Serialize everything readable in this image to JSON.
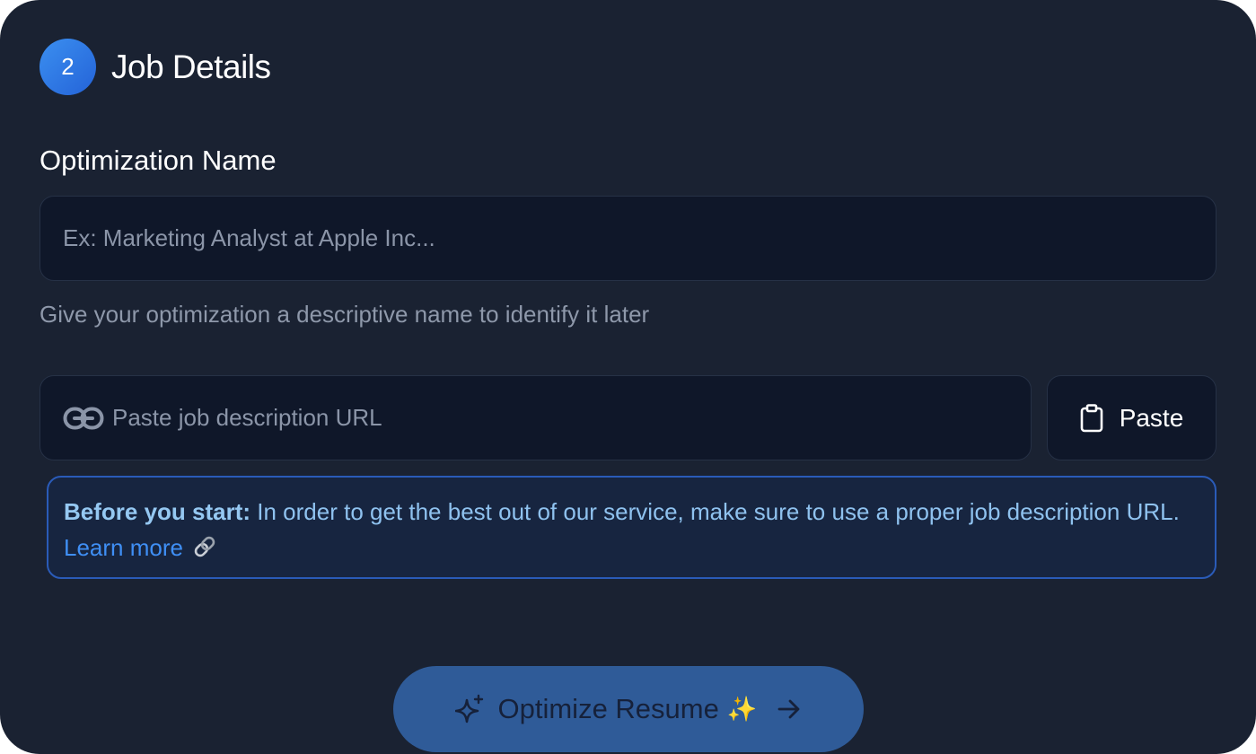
{
  "step": {
    "number": "2",
    "title": "Job Details"
  },
  "optimization_name": {
    "label": "Optimization Name",
    "value": "",
    "placeholder": "Ex: Marketing Analyst at Apple Inc...",
    "helper": "Give your optimization a descriptive name to identify it later"
  },
  "job_url": {
    "value": "",
    "placeholder": "Paste job description URL",
    "icon": "link-icon"
  },
  "paste_button": {
    "label": "Paste",
    "icon": "clipboard-icon"
  },
  "info": {
    "strong": "Before you start:",
    "text": " In order to get the best out of our service, make sure to use a proper job description URL. ",
    "link_label": "Learn more",
    "link_icon": "chain-link-icon"
  },
  "optimize_button": {
    "label": "Optimize Resume",
    "emoji": "✨",
    "leading_icon": "sparkle-icon",
    "trailing_icon": "arrow-right-icon"
  },
  "colors": {
    "card_background": "#1a2232",
    "input_background": "#0f1729",
    "accent": "#3b8ff0",
    "info_border": "#2a5bb8",
    "info_text": "#8fc2ef",
    "link": "#3f8ff5",
    "primary_button": "#2f5b98"
  }
}
